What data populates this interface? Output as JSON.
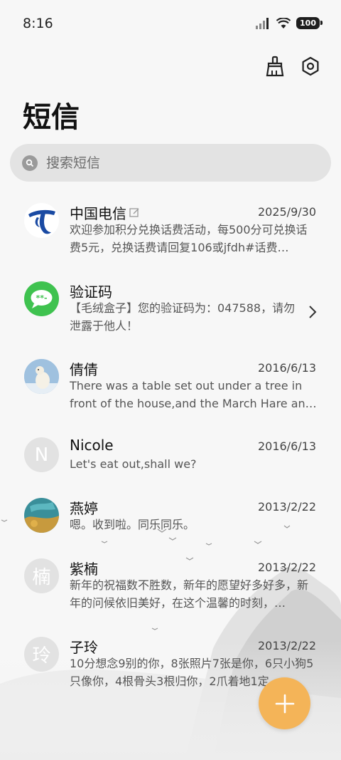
{
  "status_bar": {
    "time": "8:16",
    "battery": "100"
  },
  "header": {
    "title": "短信"
  },
  "search": {
    "placeholder": "搜索短信"
  },
  "conversations": [
    {
      "name": "中国电信",
      "date": "2025/9/30",
      "preview": "欢迎参加积分兑换话费活动，每500分可兑换话费5元，兑换话费请回复106或jfdh#话费…",
      "avatar": "telecom-logo"
    },
    {
      "name": "验证码",
      "date": "",
      "preview": "【毛绒盒子】您的验证码为：047588，请勿泄露于他人！",
      "avatar": "message-bubble"
    },
    {
      "name": "倩倩",
      "date": "2016/6/13",
      "preview": "There was a table set out under a tree in front of the house,and the March Hare an…",
      "avatar": "polar-bear-photo"
    },
    {
      "name": "Nicole",
      "date": "2016/6/13",
      "preview": "Let's eat out,shall we?",
      "avatar_letter": "N"
    },
    {
      "name": "燕婷",
      "date": "2013/2/22",
      "preview": "嗯。收到啦。同乐同乐。",
      "avatar": "painting-photo"
    },
    {
      "name": "紫楠",
      "date": "2013/2/22",
      "preview": "新年的祝福数不胜数，新年的愿望好多好多，新年的问候依旧美好，在这个温馨的时刻，…",
      "avatar_letter": "楠"
    },
    {
      "name": "子玲",
      "date": "2013/2/22",
      "preview": "10分想念9别的你，8张照片7张是你，6只小狗5只像你，4根骨头3根归你，2爪着地1定…",
      "avatar_letter": "玲"
    }
  ],
  "colors": {
    "fab": "#f4b458",
    "search_bg": "#e3e3e3",
    "accent_green": "#3fc24f",
    "telecom_blue": "#1a4aa3"
  }
}
